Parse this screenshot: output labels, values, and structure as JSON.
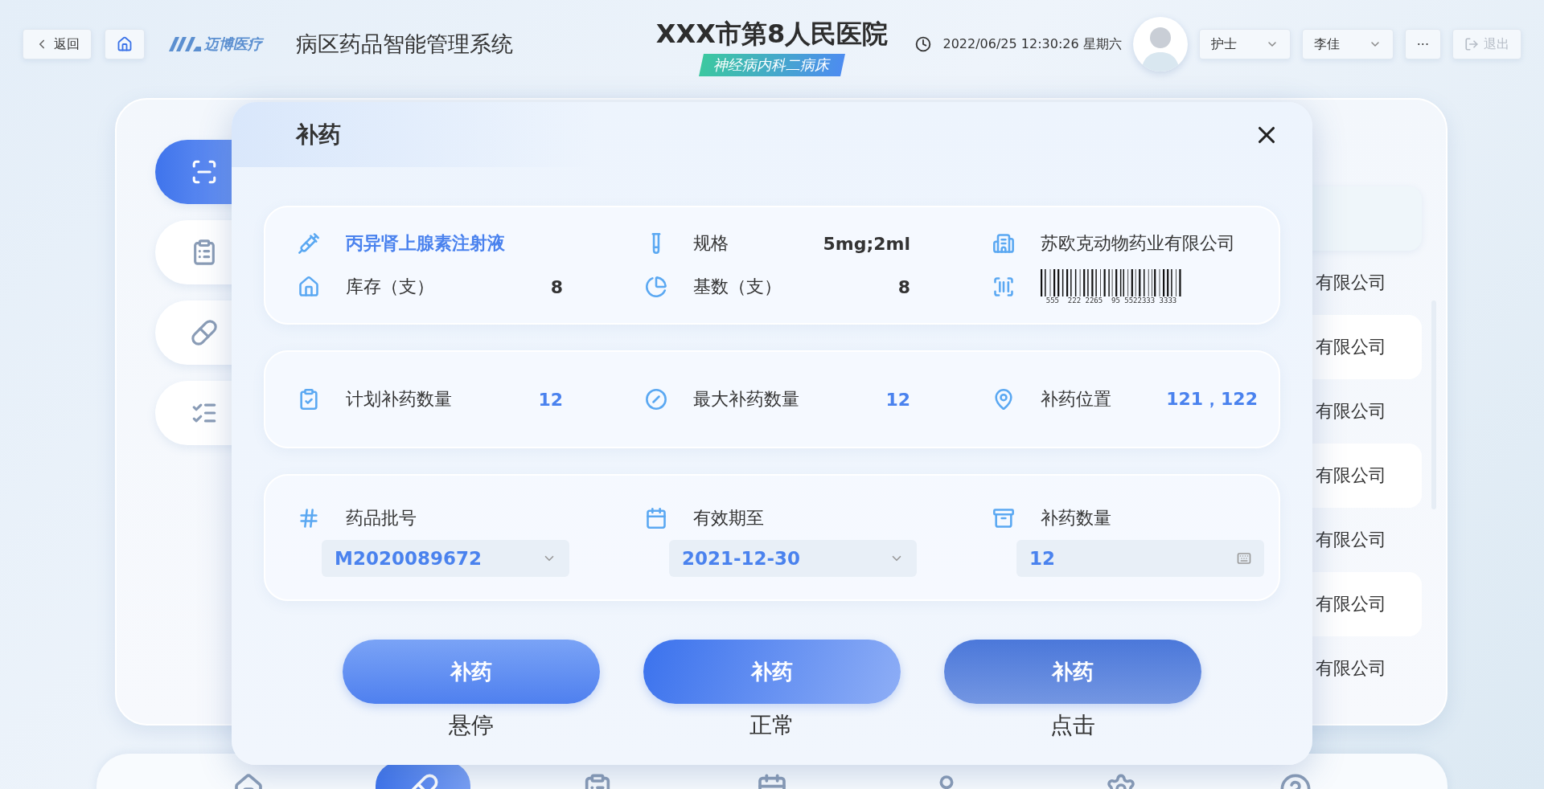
{
  "header": {
    "back": "返回",
    "logo": "迈博医疗",
    "system_title": "病区药品智能管理系统",
    "hospital": "XXX市第8人民医院",
    "ward": "神经病内科二病床",
    "datetime": "2022/06/25 12:30:26 星期六",
    "role": "护士",
    "user": "李佳",
    "more": "···",
    "logout": {
      "label": "退出",
      "disabled": true
    }
  },
  "sidebar": {
    "items": [
      {
        "kind": "scan",
        "selected": true
      },
      {
        "kind": "clipboard",
        "selected": false
      },
      {
        "kind": "pill",
        "selected": false
      },
      {
        "kind": "schedule",
        "selected": false
      }
    ]
  },
  "list": {
    "rows": [
      {
        "text": "有限公司"
      },
      {
        "text": "有限公司"
      },
      {
        "text": "有限公司"
      },
      {
        "text": "有限公司"
      },
      {
        "text": "有限公司"
      },
      {
        "text": "有限公司"
      },
      {
        "text": "有限公司"
      }
    ]
  },
  "dialog": {
    "title": "补药",
    "drug": {
      "name": "丙异肾上腺素注射液",
      "spec_label": "规格",
      "spec": "5mg;2ml",
      "manufacturer": "苏欧克动物药业有限公司",
      "stock_label": "库存（支）",
      "stock": "8",
      "base_label": "基数（支）",
      "base": "8",
      "barcode": "555  222 2265  95 5522333 3333"
    },
    "plan": [
      {
        "kind": "plan",
        "label": "计划补药数量",
        "value": "12"
      },
      {
        "kind": "max",
        "label": "最大补药数量",
        "value": "12"
      },
      {
        "kind": "location",
        "label": "补药位置",
        "value": "121，122"
      }
    ],
    "fields": [
      {
        "kind": "select",
        "label": "药品批号",
        "value": "M2020089672"
      },
      {
        "kind": "select",
        "label": "有效期至",
        "value": "2021-12-30"
      },
      {
        "kind": "keypad",
        "label": "补药数量",
        "value": "12"
      }
    ],
    "buttons": [
      {
        "label": "补药",
        "caption": "悬停",
        "kind": "hover"
      },
      {
        "label": "补药",
        "caption": "正常",
        "kind": "normal"
      },
      {
        "label": "补药",
        "caption": "点击",
        "kind": "pressed"
      }
    ]
  },
  "bottom_nav": {
    "items": [
      {
        "kind": "home",
        "selected": false
      },
      {
        "kind": "pill",
        "selected": true
      },
      {
        "kind": "list",
        "selected": false
      },
      {
        "kind": "calendar",
        "selected": false
      },
      {
        "kind": "user",
        "selected": false
      },
      {
        "kind": "settings",
        "selected": false
      },
      {
        "kind": "help",
        "selected": false
      }
    ]
  }
}
